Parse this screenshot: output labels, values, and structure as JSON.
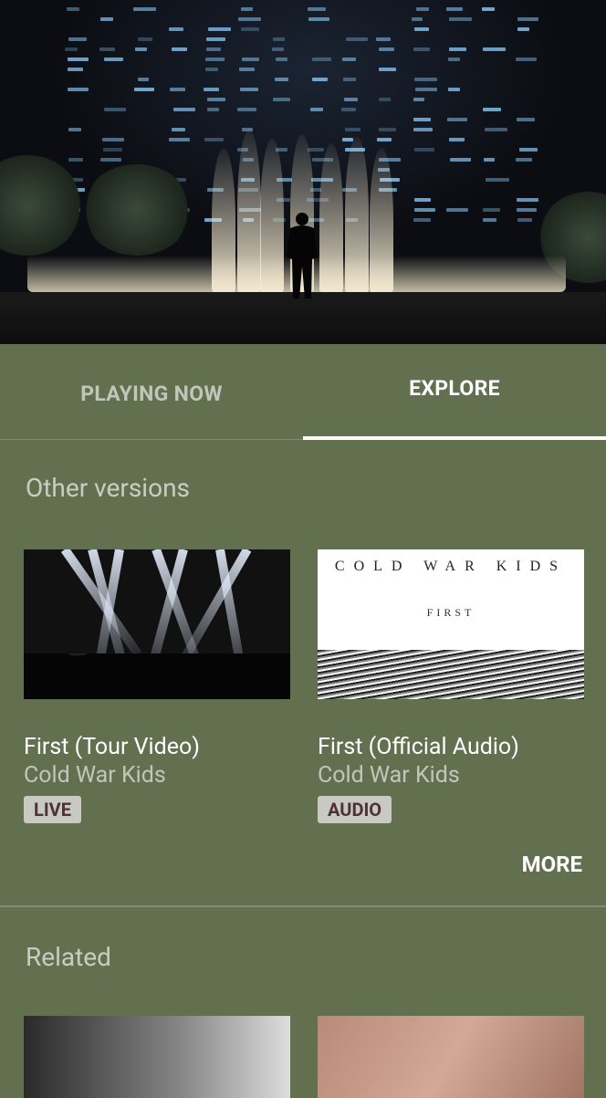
{
  "tabs": [
    {
      "label": "PLAYING NOW",
      "active": false
    },
    {
      "label": "EXPLORE",
      "active": true
    }
  ],
  "other_versions": {
    "title": "Other versions",
    "items": [
      {
        "title": "First (Tour Video)",
        "artist": "Cold War Kids",
        "badge": "LIVE",
        "thumbnail": "concert-stage-photo"
      },
      {
        "title": "First (Official Audio)",
        "artist": "Cold War Kids",
        "badge": "AUDIO",
        "thumbnail": "album-cover"
      }
    ],
    "more_label": "MORE"
  },
  "album_cover": {
    "band": "COLD WAR KIDS",
    "subtitle": "FIRST"
  },
  "related": {
    "title": "Related",
    "items": [
      {
        "thumbnail": "black-and-white-street-photo"
      },
      {
        "thumbnail": "pink-tinted-faces-photo"
      }
    ]
  },
  "colors": {
    "background": "#63704f",
    "badge_bg": "#c8c9c0",
    "badge_text": "#4e3132"
  }
}
